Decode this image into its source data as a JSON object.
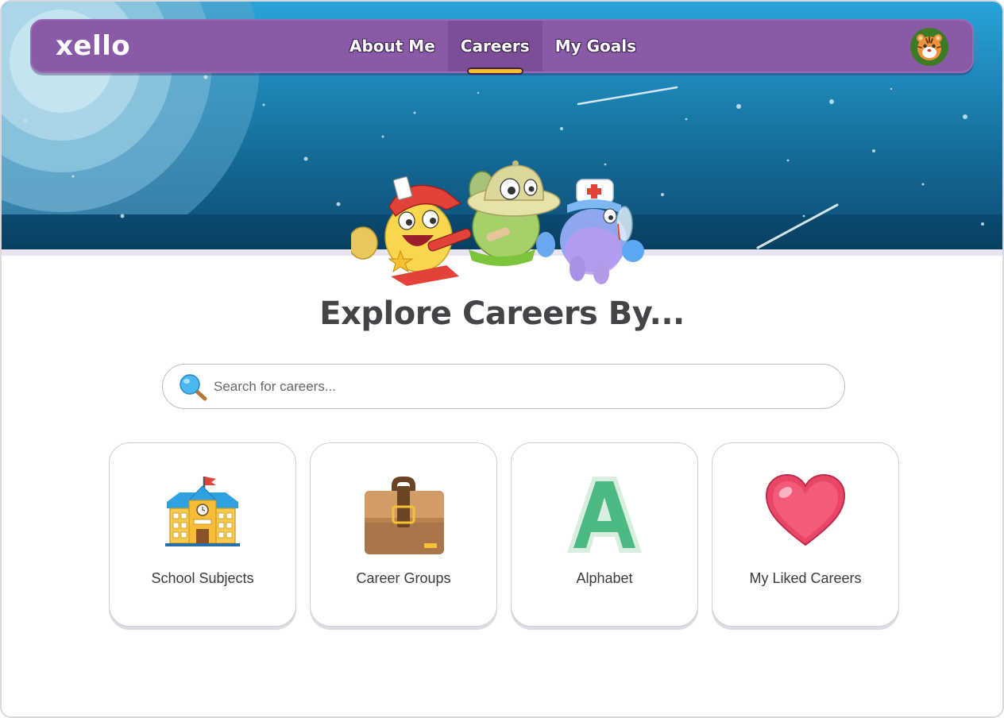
{
  "header": {
    "logo_text": "xello",
    "nav_tabs": [
      {
        "label": "About Me",
        "active": false
      },
      {
        "label": "Careers",
        "active": true
      },
      {
        "label": "My Goals",
        "active": false
      }
    ],
    "avatar_icon": "tiger-avatar-icon"
  },
  "main": {
    "title": "Explore Careers By...",
    "search": {
      "placeholder": "Search for careers...",
      "value": "",
      "icon": "search-icon"
    },
    "cards": [
      {
        "label": "School Subjects",
        "icon": "school-building-icon"
      },
      {
        "label": "Career Groups",
        "icon": "briefcase-icon"
      },
      {
        "label": "Alphabet",
        "icon": "letter-a-icon"
      },
      {
        "label": "My Liked Careers",
        "icon": "heart-icon"
      }
    ]
  },
  "colors": {
    "nav_background": "#8b5aa6",
    "active_tab_indicator": "#f6c12c",
    "sky_top": "#2aa3d8",
    "sky_bottom": "#0c4b72",
    "title_text": "#444448"
  }
}
